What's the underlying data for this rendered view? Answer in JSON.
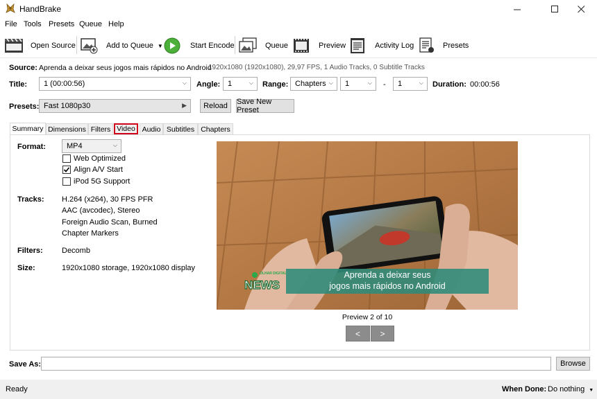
{
  "window": {
    "title": "HandBrake"
  },
  "menu": [
    "File",
    "Tools",
    "Presets",
    "Queue",
    "Help"
  ],
  "toolbar": {
    "open_source": "Open Source",
    "add_to_queue": "Add to Queue",
    "start_encode": "Start Encode",
    "queue": "Queue",
    "preview": "Preview",
    "activity_log": "Activity Log",
    "presets": "Presets"
  },
  "source": {
    "label": "Source:",
    "name": "Aprenda a deixar seus jogos mais rápidos no Android",
    "info": "1920x1080 (1920x1080), 29,97 FPS, 1 Audio Tracks, 0 Subtitle Tracks"
  },
  "title_row": {
    "title_label": "Title:",
    "title_value": "1 (00:00:56)",
    "angle_label": "Angle:",
    "angle_value": "1",
    "range_label": "Range:",
    "range_type": "Chapters",
    "range_from": "1",
    "range_dash": "-",
    "range_to": "1",
    "duration_label": "Duration:",
    "duration_value": "00:00:56"
  },
  "presets_row": {
    "label": "Presets:",
    "value": "Fast 1080p30",
    "reload": "Reload",
    "save_new": "Save New Preset"
  },
  "tabs": [
    "Summary",
    "Dimensions",
    "Filters",
    "Video",
    "Audio",
    "Subtitles",
    "Chapters"
  ],
  "highlight_color": "#d0021b",
  "summary": {
    "format_label": "Format:",
    "format_value": "MP4",
    "web_optimized": "Web Optimized",
    "align_av": "Align A/V Start",
    "ipod": "iPod 5G Support",
    "tracks_label": "Tracks:",
    "tracks": [
      "H.264 (x264), 30 FPS PFR",
      "AAC (avcodec), Stereo",
      "Foreign Audio Scan, Burned",
      "Chapter Markers"
    ],
    "filters_label": "Filters:",
    "filters_value": "Decomb",
    "size_label": "Size:",
    "size_value": "1920x1080 storage, 1920x1080 display"
  },
  "checkboxes": {
    "web_optimized": false,
    "align_av": true,
    "ipod": false
  },
  "preview": {
    "caption_line1": "Aprenda a deixar seus",
    "caption_line2": "jogos mais rápidos no Android",
    "brand_small": "OLHAR DIGITAL",
    "brand_news": "NEWS",
    "counter": "Preview 2 of 10",
    "prev": "<",
    "next": ">"
  },
  "save_as": {
    "label": "Save As:",
    "value": "",
    "browse": "Browse"
  },
  "status": {
    "text": "Ready",
    "when_done_label": "When Done:",
    "when_done_value": "Do nothing"
  }
}
